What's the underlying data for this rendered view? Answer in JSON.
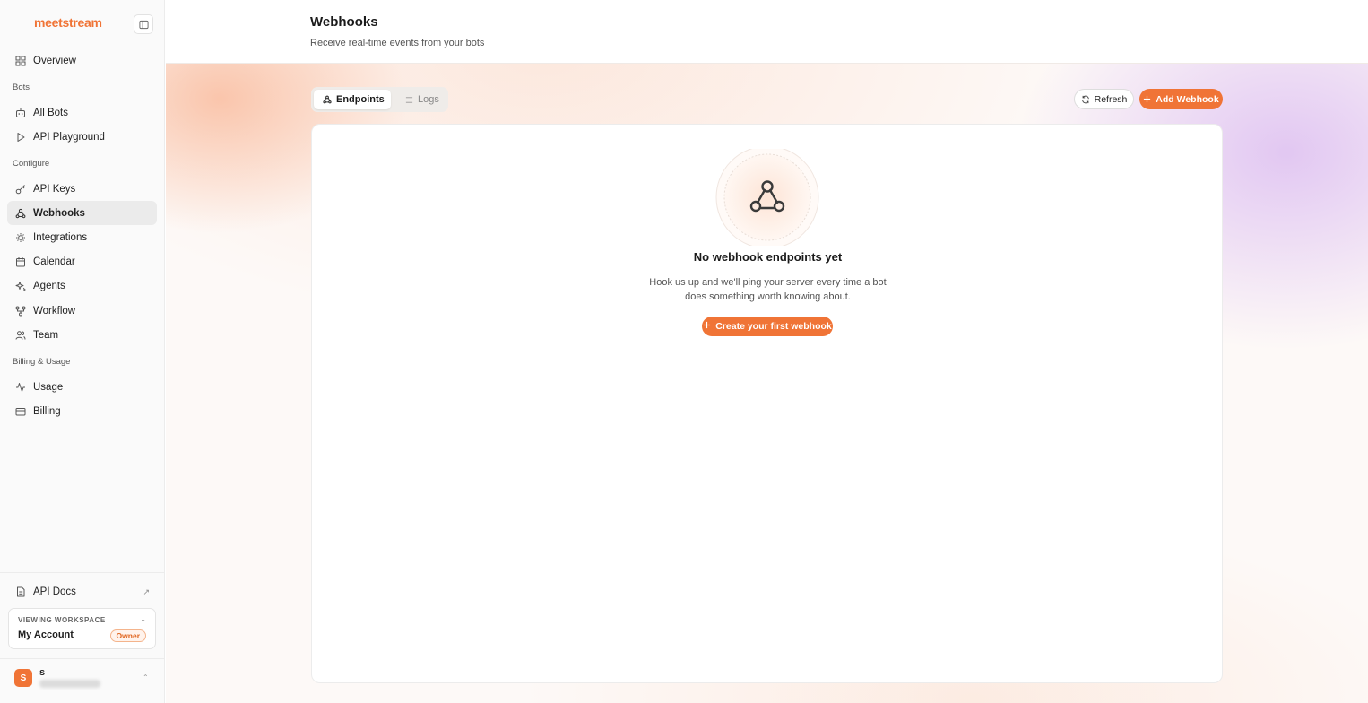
{
  "sidebar": {
    "logo": "meetstream",
    "items": {
      "overview": "Overview",
      "all_bots": "All Bots",
      "api_playground": "API Playground",
      "api_keys": "API Keys",
      "webhooks": "Webhooks",
      "integrations": "Integrations",
      "calendar": "Calendar",
      "agents": "Agents",
      "workflow": "Workflow",
      "team": "Team",
      "usage": "Usage",
      "billing": "Billing"
    },
    "sections": {
      "bots": "Bots",
      "configure": "Configure",
      "billing_usage": "Billing & Usage"
    },
    "api_docs": "API Docs",
    "workspace": {
      "label": "VIEWING WORKSPACE",
      "name": "My Account",
      "role": "Owner"
    },
    "user": {
      "initial": "S",
      "name": "s"
    }
  },
  "page": {
    "title": "Webhooks",
    "subtitle": "Receive real-time events from your bots"
  },
  "tabs": {
    "endpoints": "Endpoints",
    "logs": "Logs",
    "selected": "Endpoints"
  },
  "actions": {
    "refresh": "Refresh",
    "add_webhook": "Add Webhook"
  },
  "empty_state": {
    "title": "No webhook endpoints yet",
    "description": "Hook us up and we'll ping your server every time a bot does something worth knowing about.",
    "cta": "Create your first webhook"
  },
  "colors": {
    "accent": "#f07436",
    "active_nav": "#ebebeb"
  }
}
